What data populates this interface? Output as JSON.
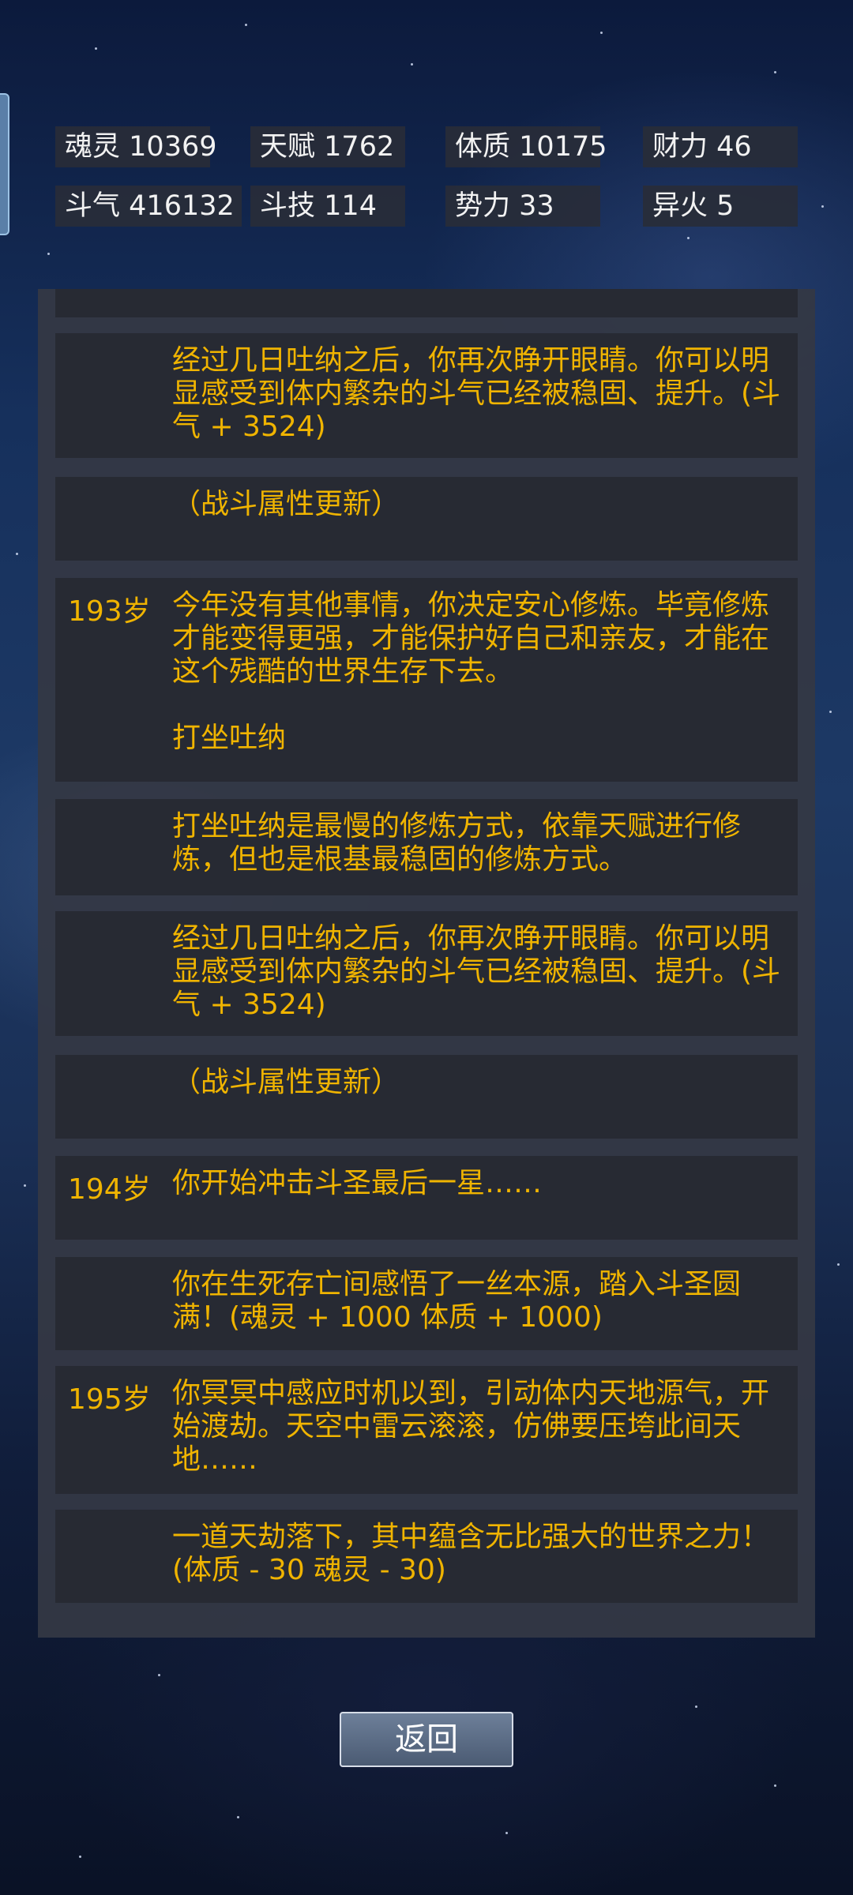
{
  "stats": [
    {
      "label": "魂灵",
      "value": "10369"
    },
    {
      "label": "天赋",
      "value": "1762"
    },
    {
      "label": "体质",
      "value": "10175"
    },
    {
      "label": "财力",
      "value": "46"
    },
    {
      "label": "斗气",
      "value": "416132"
    },
    {
      "label": "斗技",
      "value": "114"
    },
    {
      "label": "势力",
      "value": "33"
    },
    {
      "label": "异火",
      "value": "5"
    }
  ],
  "log": [
    {
      "age": "",
      "text": "经过几日吐纳之后，你再次睁开眼睛。你可以明显感受到体内繁杂的斗气已经被稳固、提升。(斗气 + 3524)"
    },
    {
      "age": "",
      "text": "（战斗属性更新）"
    },
    {
      "age": "193岁",
      "text": "今年没有其他事情，你决定安心修炼。毕竟修炼才能变得更强，才能保护好自己和亲友，才能在这个残酷的世界生存下去。\n\n打坐吐纳"
    },
    {
      "age": "",
      "text": "打坐吐纳是最慢的修炼方式，依靠天赋进行修炼，但也是根基最稳固的修炼方式。"
    },
    {
      "age": "",
      "text": "经过几日吐纳之后，你再次睁开眼睛。你可以明显感受到体内繁杂的斗气已经被稳固、提升。(斗气 + 3524)"
    },
    {
      "age": "",
      "text": "（战斗属性更新）"
    },
    {
      "age": "194岁",
      "text": "你开始冲击斗圣最后一星……"
    },
    {
      "age": "",
      "text": "你在生死存亡间感悟了一丝本源，踏入斗圣圆满！(魂灵 + 1000 体质 + 1000)"
    },
    {
      "age": "195岁",
      "text": "你冥冥中感应时机以到，引动体内天地源气，开始渡劫。天空中雷云滚滚，仿佛要压垮此间天地……"
    },
    {
      "age": "",
      "text": "一道天劫落下，其中蕴含无比强大的世界之力！(体质 - 30 魂灵 - 30)"
    }
  ],
  "buttons": {
    "back": "返回"
  },
  "colors": {
    "log_text": "#f0b400",
    "stat_text": "#f2f2f2",
    "panel": "#343844",
    "entry": "#272a33"
  }
}
